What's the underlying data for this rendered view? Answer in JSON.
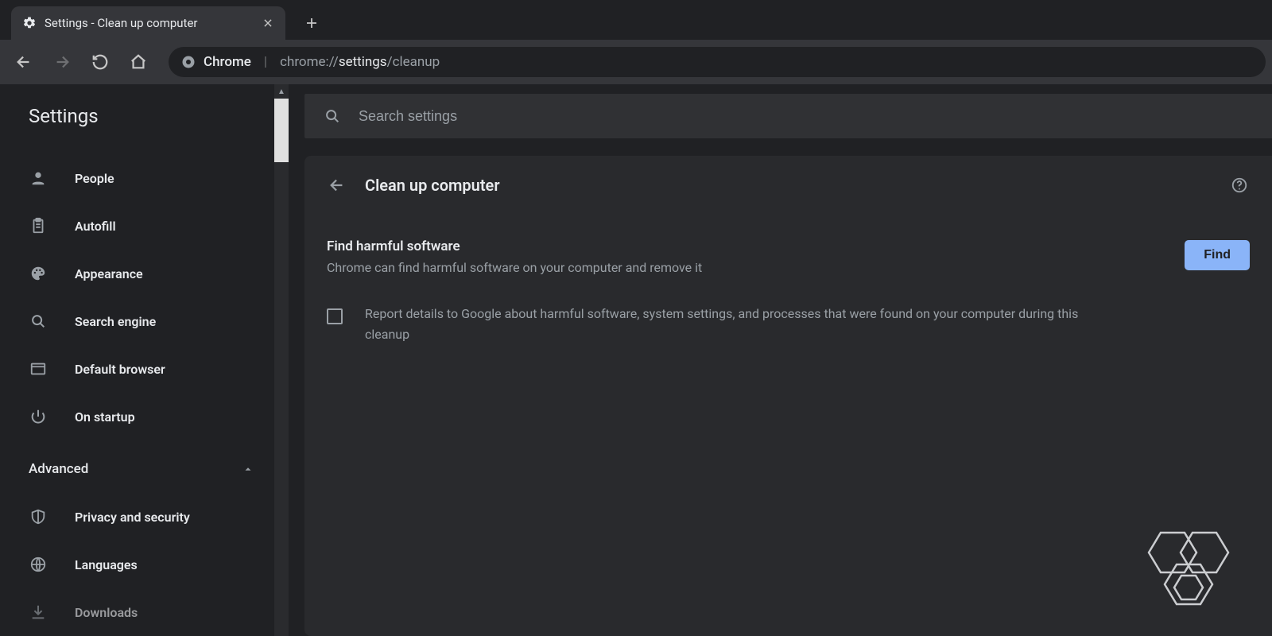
{
  "tab": {
    "title": "Settings - Clean up computer",
    "icon": "gear-icon"
  },
  "omnibox": {
    "origin_label": "Chrome",
    "url_dim1": "chrome://",
    "url_light": "settings",
    "url_dim2": "/cleanup"
  },
  "header": {
    "title": "Settings"
  },
  "sidebar": {
    "items": [
      {
        "icon": "person-icon",
        "label": "People"
      },
      {
        "icon": "clipboard-icon",
        "label": "Autofill"
      },
      {
        "icon": "palette-icon",
        "label": "Appearance"
      },
      {
        "icon": "search-icon",
        "label": "Search engine"
      },
      {
        "icon": "browser-icon",
        "label": "Default browser"
      },
      {
        "icon": "power-icon",
        "label": "On startup"
      }
    ],
    "section_label": "Advanced",
    "advanced_items": [
      {
        "icon": "shield-icon",
        "label": "Privacy and security"
      },
      {
        "icon": "globe-icon",
        "label": "Languages"
      },
      {
        "icon": "download-icon",
        "label": "Downloads"
      }
    ]
  },
  "search": {
    "placeholder": "Search settings"
  },
  "card": {
    "title": "Clean up computer",
    "find": {
      "heading": "Find harmful software",
      "sub": "Chrome can find harmful software on your computer and remove it",
      "button": "Find"
    },
    "report": {
      "text": "Report details to Google about harmful software, system settings, and processes that were found on your computer during this cleanup",
      "checked": false
    }
  }
}
